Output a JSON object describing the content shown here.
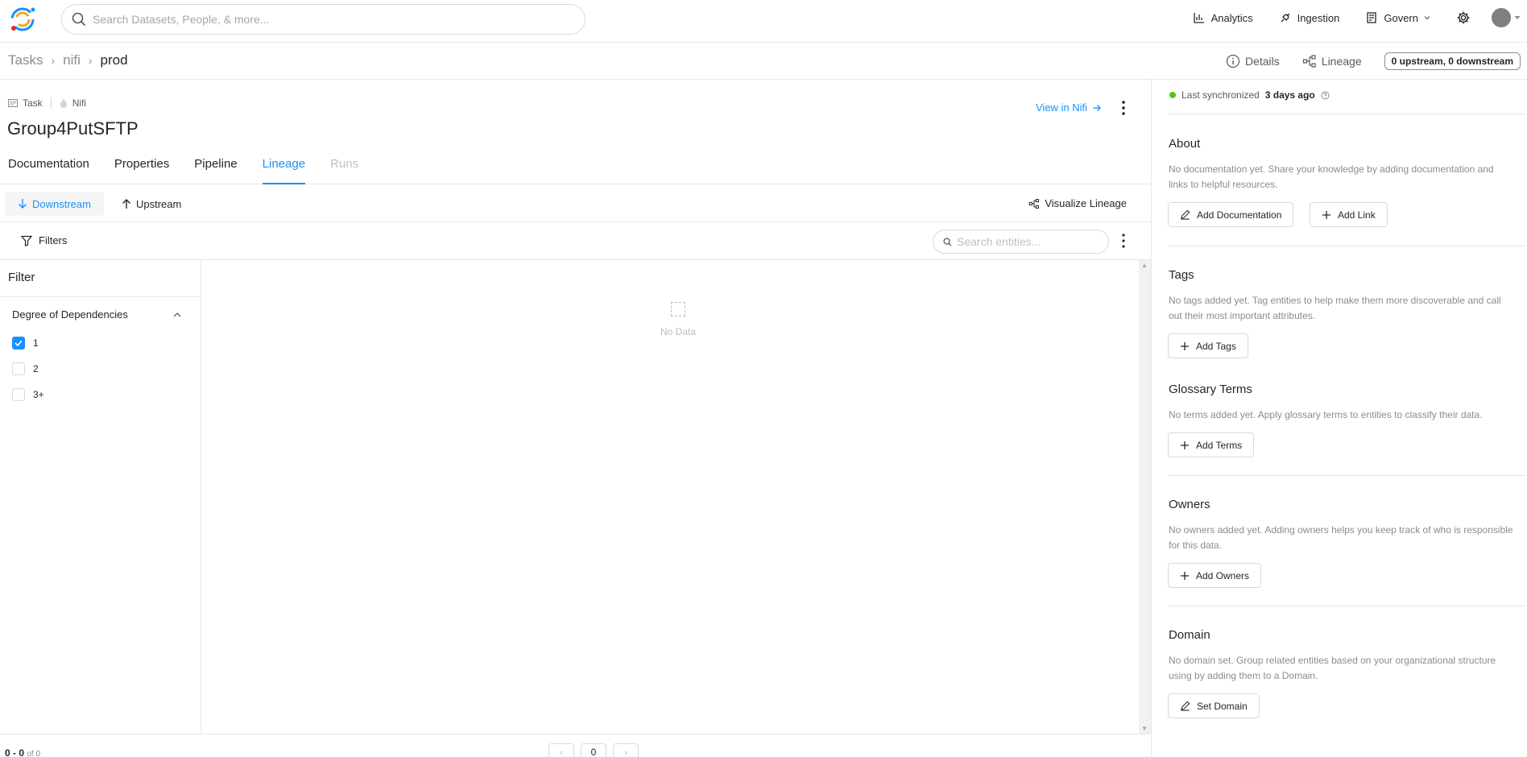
{
  "topnav": {
    "search_placeholder": "Search Datasets, People, & more...",
    "links": {
      "analytics": "Analytics",
      "ingestion": "Ingestion",
      "govern": "Govern"
    }
  },
  "breadcrumb": {
    "items": [
      "Tasks",
      "nifi"
    ],
    "current": "prod"
  },
  "header": {
    "details": "Details",
    "lineage": "Lineage",
    "lineage_count": "0 upstream, 0 downstream"
  },
  "entity": {
    "type": "Task",
    "platform": "Nifi",
    "title": "Group4PutSFTP",
    "view_link": "View in Nifi"
  },
  "tabs": [
    "Documentation",
    "Properties",
    "Pipeline",
    "Lineage",
    "Runs"
  ],
  "lineage": {
    "downstream": "Downstream",
    "upstream": "Upstream",
    "visualize": "Visualize Lineage",
    "filters": "Filters",
    "search_placeholder": "Search entities...",
    "filter_title": "Filter",
    "group_title": "Degree of Dependencies",
    "options": [
      "1",
      "2",
      "3+"
    ],
    "no_data": "No Data",
    "page_count": "0 - 0",
    "page_of": "of 0",
    "page_num": "0"
  },
  "sidebar": {
    "sync_prefix": "Last synchronized",
    "sync_time": "3 days ago",
    "about": {
      "title": "About",
      "desc": "No documentation yet. Share your knowledge by adding documentation and links to helpful resources.",
      "add_doc": "Add Documentation",
      "add_link": "Add Link"
    },
    "tags": {
      "title": "Tags",
      "desc": "No tags added yet. Tag entities to help make them more discoverable and call out their most important attributes.",
      "btn": "Add Tags"
    },
    "glossary": {
      "title": "Glossary Terms",
      "desc": "No terms added yet. Apply glossary terms to entities to classify their data.",
      "btn": "Add Terms"
    },
    "owners": {
      "title": "Owners",
      "desc": "No owners added yet. Adding owners helps you keep track of who is responsible for this data.",
      "btn": "Add Owners"
    },
    "domain": {
      "title": "Domain",
      "desc": "No domain set. Group related entities based on your organizational structure using by adding them to a Domain.",
      "btn": "Set Domain"
    }
  },
  "colors": {
    "accent": "#1890ff",
    "sync": "#52c41a"
  }
}
